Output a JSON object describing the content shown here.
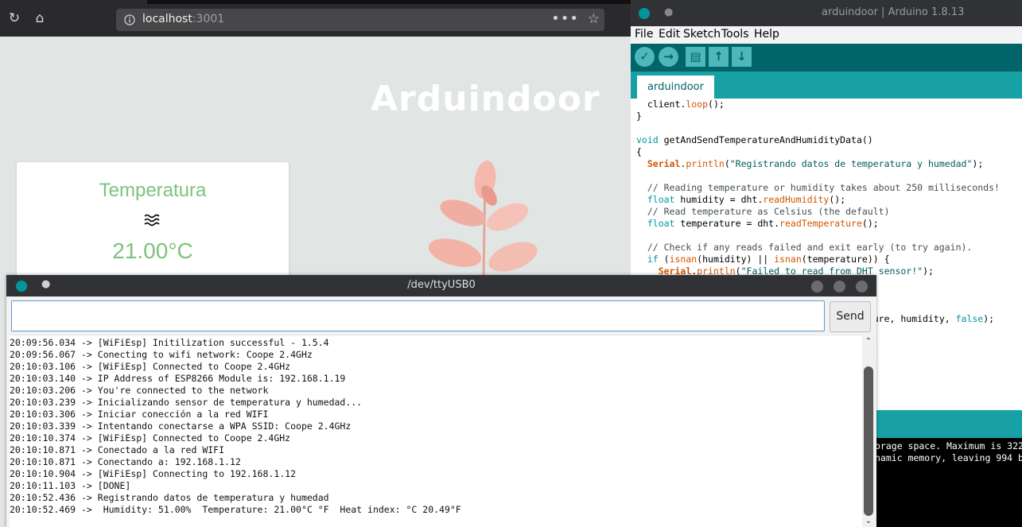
{
  "browser": {
    "url_host": "localhost",
    "url_port": ":3001",
    "url_menu": "•••",
    "page_title": "Arduindoor",
    "temperature_card": {
      "title": "Temperatura",
      "icon": "waves-icon",
      "value": "21.00°C"
    }
  },
  "ide": {
    "title": "arduindoor | Arduino 1.8.13",
    "menu": [
      "File",
      "Edit",
      "Sketch",
      "Tools",
      "Help"
    ],
    "toolbar_icons": [
      "verify-icon",
      "upload-icon",
      "new-icon",
      "open-icon",
      "save-icon"
    ],
    "tab": "arduindoor",
    "console_lines": [
      "orage space. Maximum is 322",
      "namic memory, leaving 994 b"
    ]
  },
  "serial": {
    "title": "/dev/ttyUSB0",
    "dot": "●",
    "input_value": "",
    "send_label": "Send",
    "lines": [
      "20:09:56.034 -> [WiFiEsp] Initilization successful - 1.5.4",
      "20:09:56.067 -> Conecting to wifi network: Coope 2.4GHz",
      "20:10:03.106 -> [WiFiEsp] Connected to Coope 2.4GHz",
      "20:10:03.140 -> IP Address of ESP8266 Module is: 192.168.1.19",
      "20:10:03.206 -> You're connected to the network",
      "20:10:03.239 -> Inicializando sensor de temperatura y humedad...",
      "20:10:03.306 -> Iniciar conección a la red WIFI",
      "20:10:03.339 -> Intentando conectarse a WPA SSID: Coope 2.4GHz",
      "20:10:10.374 -> [WiFiEsp] Connected to Coope 2.4GHz",
      "20:10:10.871 -> Conectado a la red WIFI",
      "20:10:10.871 -> Conectando a: 192.168.1.12",
      "20:10:10.904 -> [WiFiEsp] Connecting to 192.168.1.12",
      "20:10:11.103 -> [DONE]",
      "20:10:52.436 -> Registrando datos de temperatura y humedad",
      "20:10:52.469 ->  Humidity: 51.00%  Temperature: 21.00°C °F  Heat index: °C 20.49°F"
    ]
  }
}
